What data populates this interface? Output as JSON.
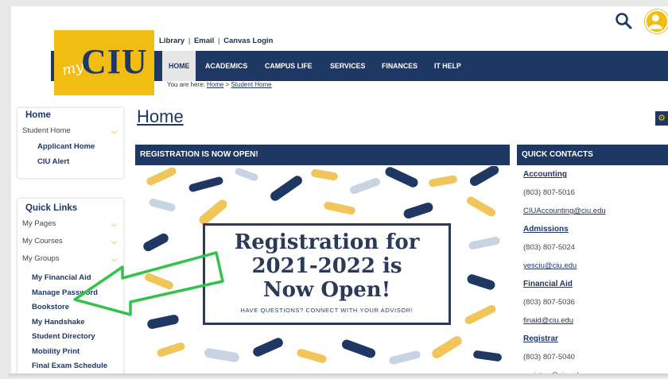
{
  "header": {
    "logo_my": "my",
    "logo_ciu": "CIU",
    "links": [
      "Library",
      "Email",
      "Canvas Login"
    ],
    "link_sep": "|"
  },
  "nav": {
    "items": [
      "HOME",
      "ACADEMICS",
      "CAMPUS LIFE",
      "SERVICES",
      "FINANCES",
      "IT HELP"
    ],
    "active": "HOME"
  },
  "breadcrumb": {
    "prefix": "You are here:",
    "home": "Home",
    "sep": ">",
    "current": "Student Home"
  },
  "sidebar": {
    "home_box": {
      "title": "Home",
      "section": "Student Home",
      "links": [
        "Applicant Home",
        "CIU Alert"
      ]
    },
    "quick_links": {
      "title": "Quick Links",
      "sections": [
        "My Pages",
        "My Courses",
        "My Groups"
      ],
      "links": [
        "My Financial Aid",
        "Manage Password",
        "Bookstore",
        "My Handshake",
        "Student Directory",
        "Mobility Print",
        "Final Exam Schedule"
      ]
    }
  },
  "main": {
    "title": "Home",
    "announcement": {
      "header": "REGISTRATION IS NOW OPEN!",
      "line1": "Registration for",
      "line2": "2021-2022 is",
      "line3": "Now Open!",
      "sub": "HAVE QUESTIONS? CONNECT WITH YOUR ADVISOR!"
    }
  },
  "quick_contacts": {
    "header": "QUICK CONTACTS",
    "entries": [
      {
        "name": "Accounting",
        "phone": "(803) 807-5016",
        "email": "CIUAccounting@ciu.edu"
      },
      {
        "name": "Admissions",
        "phone": "(803) 807-5024",
        "email": "yesciu@ciu.edu"
      },
      {
        "name": "Financial Aid",
        "phone": "(803) 807-5036",
        "email": "finaid@ciu.edu"
      },
      {
        "name": "Registrar",
        "phone": "(803) 807-5040",
        "email": "registrar@ciu.edu"
      }
    ]
  },
  "colors": {
    "navy": "#1f3763",
    "gold": "#f2bd13",
    "annotation_arrow": "#35c24a"
  },
  "icons": [
    "search-icon",
    "user-avatar-icon",
    "chevron-down-icon",
    "gear-icon"
  ]
}
